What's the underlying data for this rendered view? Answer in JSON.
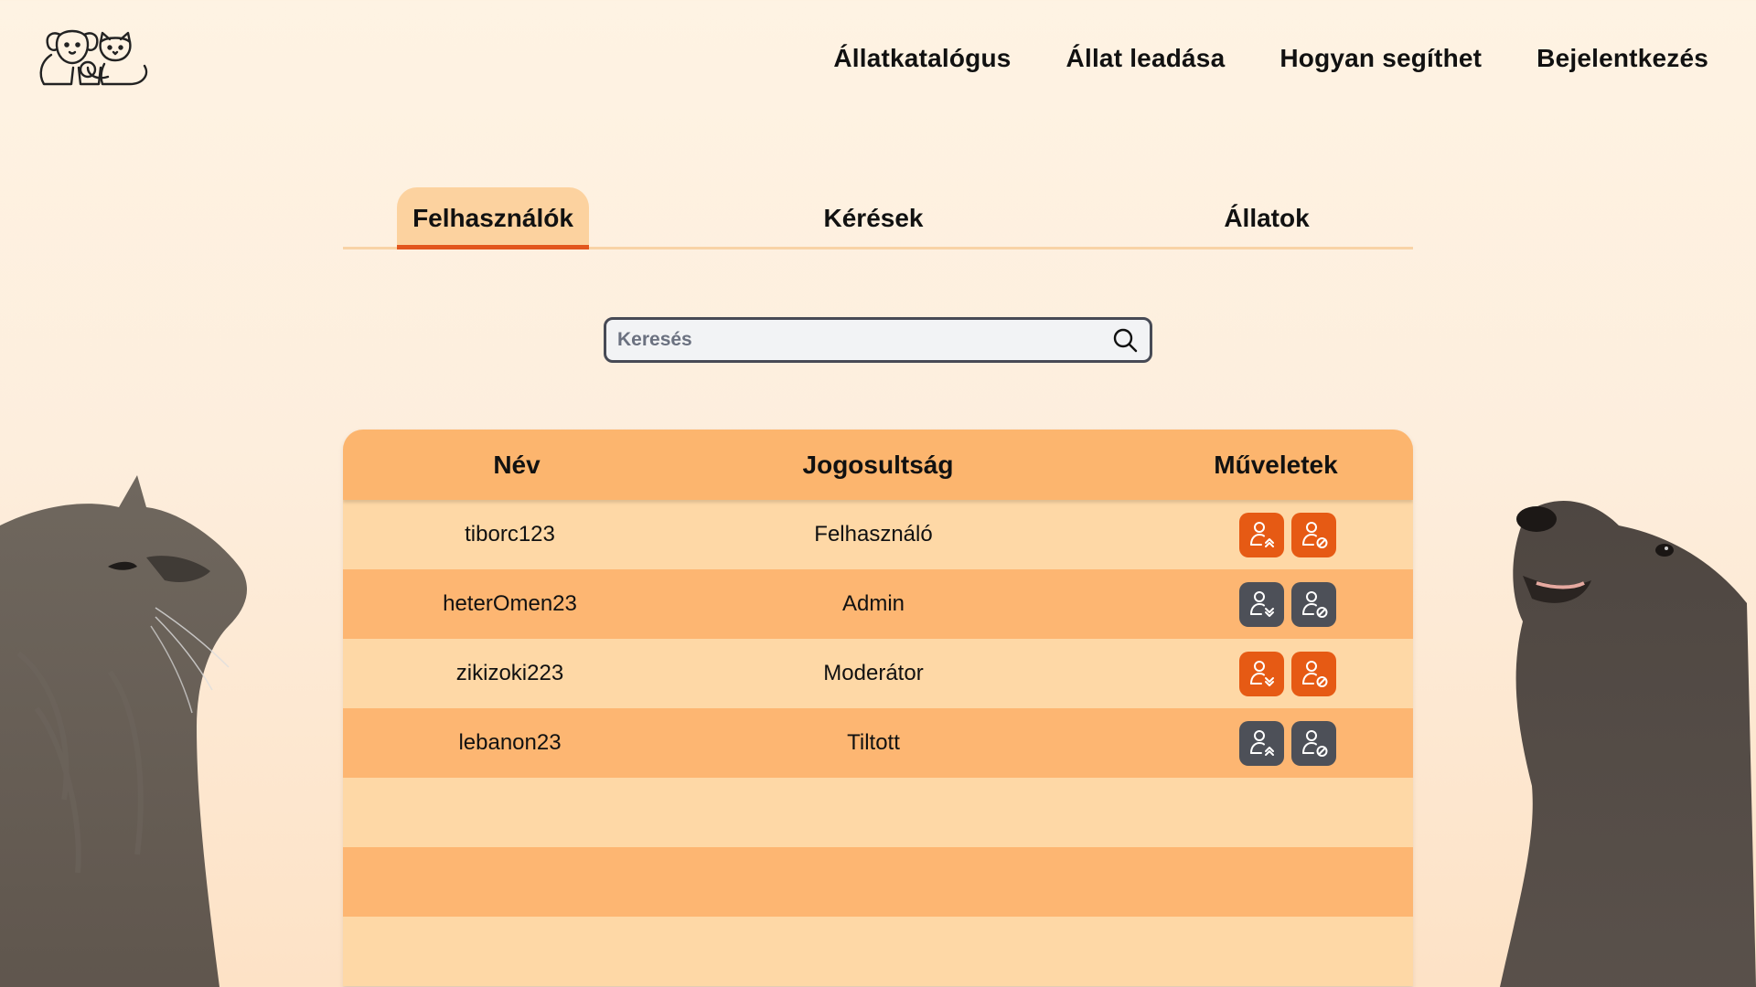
{
  "nav": {
    "items": [
      {
        "label": "Állatkatalógus",
        "name": "nav-catalog"
      },
      {
        "label": "Állat leadása",
        "name": "nav-surrender"
      },
      {
        "label": "Hogyan segíthet",
        "name": "nav-how-to-help"
      },
      {
        "label": "Bejelentkezés",
        "name": "nav-login"
      }
    ]
  },
  "tabs": [
    {
      "label": "Felhasználók",
      "active": true
    },
    {
      "label": "Kérések",
      "active": false
    },
    {
      "label": "Állatok",
      "active": false
    }
  ],
  "search": {
    "placeholder": "Keresés",
    "value": ""
  },
  "table": {
    "headers": [
      "Név",
      "Jogosultság",
      "Műveletek"
    ],
    "rows": [
      {
        "name": "tiborc123",
        "role": "Felhasználó",
        "buttons": [
          {
            "icon": "user-promote-icon",
            "color": "orange"
          },
          {
            "icon": "user-ban-icon",
            "color": "orange"
          }
        ]
      },
      {
        "name": "heterOmen23",
        "role": "Admin",
        "buttons": [
          {
            "icon": "user-demote-icon",
            "color": "gray"
          },
          {
            "icon": "user-ban-icon",
            "color": "gray"
          }
        ]
      },
      {
        "name": "zikizoki223",
        "role": "Moderátor",
        "buttons": [
          {
            "icon": "user-demote-icon",
            "color": "orange"
          },
          {
            "icon": "user-ban-icon",
            "color": "orange"
          }
        ]
      },
      {
        "name": "lebanon23",
        "role": "Tiltott",
        "buttons": [
          {
            "icon": "user-promote-icon",
            "color": "gray"
          },
          {
            "icon": "user-ban-icon",
            "color": "gray"
          }
        ]
      }
    ],
    "empty_rows": 3
  },
  "colors": {
    "accent": "#e65a14",
    "tab_active_bg": "#fcd29f",
    "tab_underline": "#e2561e",
    "header_bg": "#fcb56e",
    "row_light": "#fed8a6",
    "row_dark": "#fdb672",
    "button_gray": "#4d5058"
  },
  "icons": {
    "logo": "dog-cat-logo-icon",
    "search": "search-icon"
  }
}
